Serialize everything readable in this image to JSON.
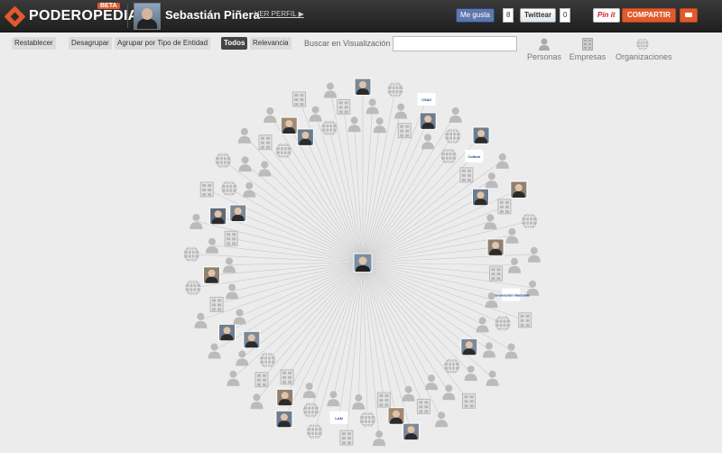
{
  "header": {
    "brand": "PODEROPEDIA",
    "beta_badge": "BETA",
    "profile_name": "Sebastián Piñera",
    "profile_link": "VER PERFIL ▶",
    "facebook_like": "Me gusta",
    "facebook_count": "8",
    "twitter_label": "Twittear",
    "twitter_count": "0",
    "pinterest_label": "Pin it",
    "share_label": "COMPARTIR",
    "print_icon": "printer-icon"
  },
  "toolbar": {
    "reset": "Restablecer",
    "ungroup": "Desagrupar",
    "group_by_type": "Agrupar por Tipo de Entidad",
    "all": "Todos",
    "relevance": "Relevancia",
    "search_label": "Buscar en Visualización",
    "search_value": ""
  },
  "filters": [
    {
      "label": "Personas",
      "icon": "person-icon"
    },
    {
      "label": "Empresas",
      "icon": "building-icon"
    },
    {
      "label": "Organizaciones",
      "icon": "globe-icon"
    }
  ],
  "graph": {
    "center": "photo",
    "edge_color": "#c8c8c8",
    "node_color": "#bbbbbb",
    "nodes": [
      "photo",
      "person",
      "person",
      "globe",
      "person",
      "building",
      "logo-text",
      "photo",
      "person",
      "person",
      "globe",
      "globe",
      "photo",
      "logo-text",
      "building",
      "person",
      "person",
      "photo",
      "photo",
      "building",
      "person",
      "globe",
      "person",
      "photo",
      "person",
      "person",
      "building",
      "person",
      "logo-text",
      "person",
      "building",
      "globe",
      "person",
      "person",
      "person",
      "photo",
      "person",
      "person",
      "globe",
      "building",
      "person",
      "person",
      "person",
      "building",
      "person",
      "photo",
      "photo",
      "building",
      "person",
      "globe",
      "person",
      "building",
      "logo-text",
      "person",
      "globe",
      "globe",
      "person",
      "photo",
      "photo",
      "building",
      "person",
      "building",
      "globe",
      "person",
      "person",
      "photo",
      "person",
      "photo",
      "person",
      "person",
      "building",
      "person",
      "globe",
      "photo",
      "person",
      "globe",
      "person",
      "building",
      "person",
      "photo",
      "photo",
      "building",
      "globe",
      "person",
      "globe",
      "person",
      "person",
      "person",
      "building",
      "globe",
      "person",
      "photo",
      "photo",
      "building",
      "person",
      "globe",
      "person",
      "building",
      "person"
    ],
    "logo_texts": {
      "6": "CSAV",
      "13": "Colbún",
      "28": "Renovación Nacional",
      "52": "LAN"
    }
  }
}
